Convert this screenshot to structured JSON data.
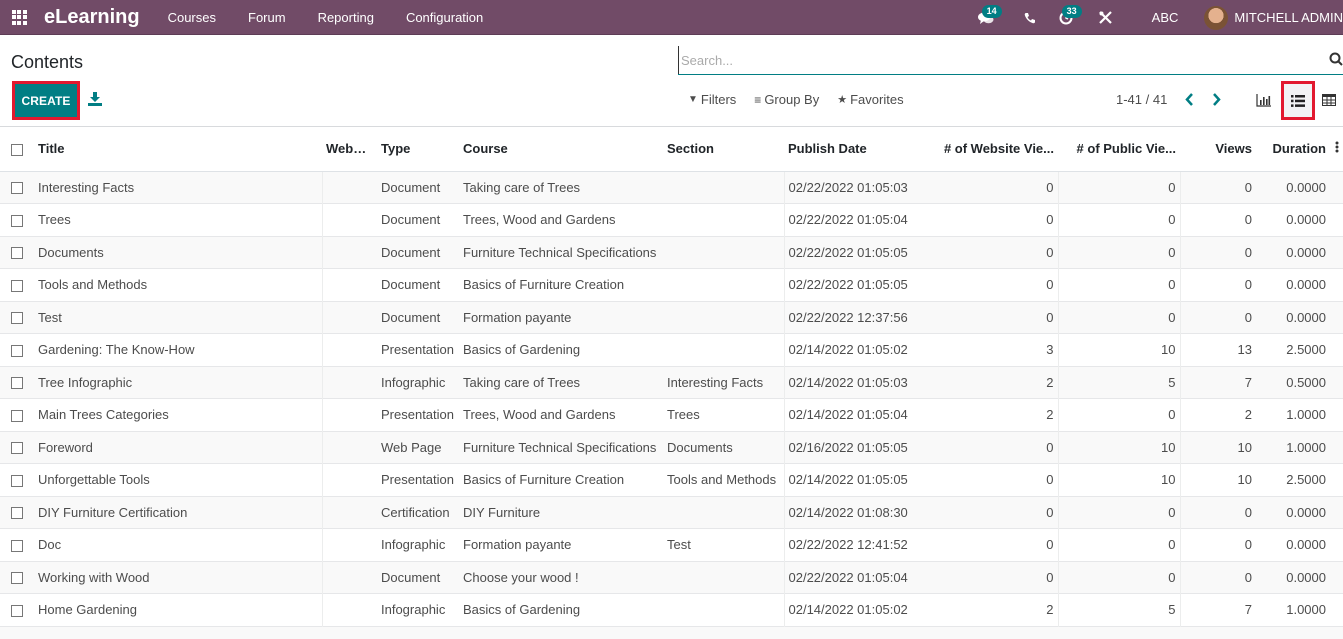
{
  "navbar": {
    "apps_icon": "apps-grid-icon",
    "brand": "eLearning",
    "menu": [
      "Courses",
      "Forum",
      "Reporting",
      "Configuration"
    ],
    "messages_badge": "14",
    "activities_badge": "33",
    "company": "ABC",
    "user": "MITCHELL ADMIN"
  },
  "control_panel": {
    "breadcrumb": "Contents",
    "create_label": "CREATE",
    "search_placeholder": "Search...",
    "filters_label": "Filters",
    "group_by_label": "Group By",
    "favorites_label": "Favorites",
    "pager": "1-41 / 41",
    "active_view": "list",
    "views": [
      "graph",
      "list",
      "pivot"
    ]
  },
  "colors": {
    "navbar": "#714b67",
    "primary": "#017e84",
    "highlight_box": "#e2192f"
  },
  "table": {
    "columns": [
      "Title",
      "Website",
      "Type",
      "Course",
      "Section",
      "Publish Date",
      "# of Website Vie...",
      "# of Public Vie...",
      "Views",
      "Duration"
    ],
    "rows": [
      {
        "title": "Interesting Facts",
        "website": "",
        "type": "Document",
        "course": "Taking care of Trees",
        "section": "",
        "publish_date": "02/22/2022 01:05:03",
        "website_views": "0",
        "public_views": "0",
        "views": "0",
        "duration": "0.0000"
      },
      {
        "title": "Trees",
        "website": "",
        "type": "Document",
        "course": "Trees, Wood and Gardens",
        "section": "",
        "publish_date": "02/22/2022 01:05:04",
        "website_views": "0",
        "public_views": "0",
        "views": "0",
        "duration": "0.0000"
      },
      {
        "title": "Documents",
        "website": "",
        "type": "Document",
        "course": "Furniture Technical Specifications",
        "section": "",
        "publish_date": "02/22/2022 01:05:05",
        "website_views": "0",
        "public_views": "0",
        "views": "0",
        "duration": "0.0000"
      },
      {
        "title": "Tools and Methods",
        "website": "",
        "type": "Document",
        "course": "Basics of Furniture Creation",
        "section": "",
        "publish_date": "02/22/2022 01:05:05",
        "website_views": "0",
        "public_views": "0",
        "views": "0",
        "duration": "0.0000"
      },
      {
        "title": "Test",
        "website": "",
        "type": "Document",
        "course": "Formation payante",
        "section": "",
        "publish_date": "02/22/2022 12:37:56",
        "website_views": "0",
        "public_views": "0",
        "views": "0",
        "duration": "0.0000"
      },
      {
        "title": "Gardening: The Know-How",
        "website": "",
        "type": "Presentation",
        "course": "Basics of Gardening",
        "section": "",
        "publish_date": "02/14/2022 01:05:02",
        "website_views": "3",
        "public_views": "10",
        "views": "13",
        "duration": "2.5000"
      },
      {
        "title": "Tree Infographic",
        "website": "",
        "type": "Infographic",
        "course": "Taking care of Trees",
        "section": "Interesting Facts",
        "publish_date": "02/14/2022 01:05:03",
        "website_views": "2",
        "public_views": "5",
        "views": "7",
        "duration": "0.5000"
      },
      {
        "title": "Main Trees Categories",
        "website": "",
        "type": "Presentation",
        "course": "Trees, Wood and Gardens",
        "section": "Trees",
        "publish_date": "02/14/2022 01:05:04",
        "website_views": "2",
        "public_views": "0",
        "views": "2",
        "duration": "1.0000"
      },
      {
        "title": "Foreword",
        "website": "",
        "type": "Web Page",
        "course": "Furniture Technical Specifications",
        "section": "Documents",
        "publish_date": "02/16/2022 01:05:05",
        "website_views": "0",
        "public_views": "10",
        "views": "10",
        "duration": "1.0000"
      },
      {
        "title": "Unforgettable Tools",
        "website": "",
        "type": "Presentation",
        "course": "Basics of Furniture Creation",
        "section": "Tools and Methods",
        "publish_date": "02/14/2022 01:05:05",
        "website_views": "0",
        "public_views": "10",
        "views": "10",
        "duration": "2.5000"
      },
      {
        "title": "DIY Furniture Certification",
        "website": "",
        "type": "Certification",
        "course": "DIY Furniture",
        "section": "",
        "publish_date": "02/14/2022 01:08:30",
        "website_views": "0",
        "public_views": "0",
        "views": "0",
        "duration": "0.0000"
      },
      {
        "title": "Doc",
        "website": "",
        "type": "Infographic",
        "course": "Formation payante",
        "section": "Test",
        "publish_date": "02/22/2022 12:41:52",
        "website_views": "0",
        "public_views": "0",
        "views": "0",
        "duration": "0.0000"
      },
      {
        "title": "Working with Wood",
        "website": "",
        "type": "Document",
        "course": "Choose your wood !",
        "section": "",
        "publish_date": "02/22/2022 01:05:04",
        "website_views": "0",
        "public_views": "0",
        "views": "0",
        "duration": "0.0000"
      },
      {
        "title": "Home Gardening",
        "website": "",
        "type": "Infographic",
        "course": "Basics of Gardening",
        "section": "",
        "publish_date": "02/14/2022 01:05:02",
        "website_views": "2",
        "public_views": "5",
        "views": "7",
        "duration": "1.0000"
      }
    ]
  }
}
